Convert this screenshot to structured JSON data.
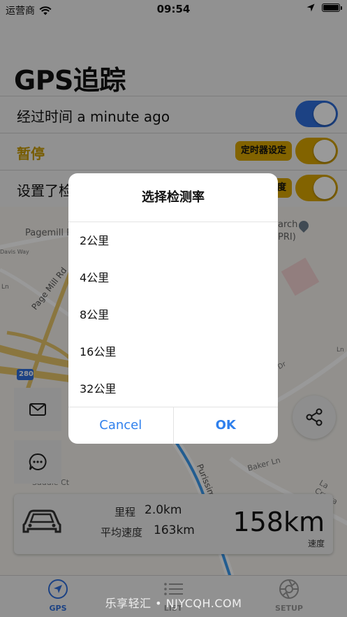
{
  "status_bar": {
    "carrier": "运营商",
    "time": "09:54"
  },
  "header": {
    "title": "GPS追踪"
  },
  "settings": {
    "elapsed_label": "经过时间 a minute ago",
    "paused_label": "暂停",
    "timer_button": "定时器设定",
    "rate_label": "设置了检",
    "rate_button": "度"
  },
  "map": {
    "labels": {
      "pagemill": "Pagemill Road",
      "page_mill_rd": "Page Mill Rd",
      "search_frag": "arch",
      "sri_frag": "PRI)",
      "davis_way": "Davis Way",
      "ln_frag": "Ln",
      "ln_frag2": "Ln",
      "hwy": "280",
      "dr_frag": "Dr",
      "purissima": "Purissima R",
      "baker_ln": "Baker Ln",
      "saddle_ct": "Saddle Ct",
      "la_cresta": "La Cresta"
    }
  },
  "trip": {
    "distance_label": "里程",
    "distance_value": "2.0km",
    "avg_speed_label": "平均速度",
    "avg_speed_value": "163km",
    "speed_value": "158km",
    "speed_unit": "速度"
  },
  "tabs": [
    {
      "label": "GPS"
    },
    {
      "label": "LIST"
    },
    {
      "label": "SETUP"
    }
  ],
  "watermark": "乐享轻汇 • NJYCQH.COM",
  "dialog": {
    "title": "选择检测率",
    "options": [
      "2公里",
      "4公里",
      "8公里",
      "16公里",
      "32公里"
    ],
    "cancel": "Cancel",
    "ok": "OK"
  },
  "colors": {
    "accent": "#2f6fdc",
    "gold": "#d9a600",
    "link": "#2f80ed"
  }
}
